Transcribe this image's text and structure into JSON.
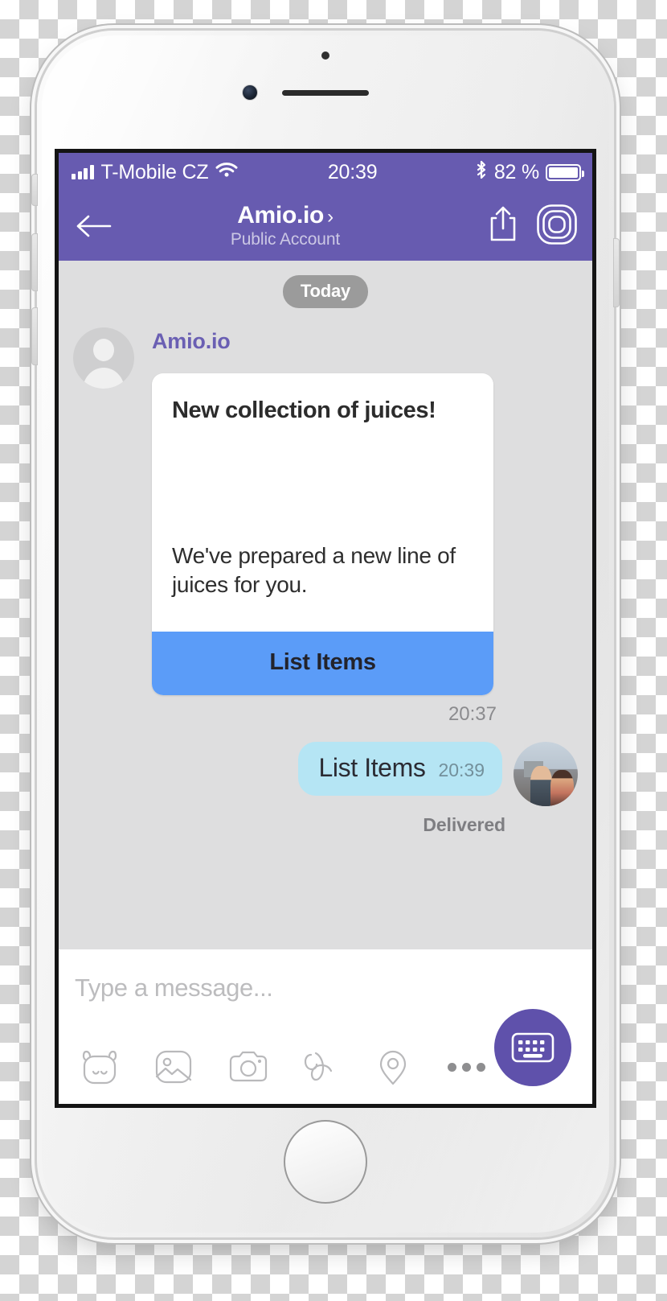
{
  "status_bar": {
    "carrier": "T-Mobile CZ",
    "time": "20:39",
    "battery_percent": "82 %",
    "icons": [
      "signal-bars-icon",
      "wifi-icon",
      "bluetooth-icon",
      "battery-icon"
    ]
  },
  "header": {
    "back_icon": "back-arrow-icon",
    "title": "Amio.io",
    "chevron": "›",
    "subtitle": "Public Account",
    "actions": [
      "share-icon",
      "viber-camera-icon"
    ],
    "background_color": "#675bb0"
  },
  "conversation": {
    "day_separator": "Today",
    "incoming": {
      "sender": "Amio.io",
      "avatar": "default-avatar-icon",
      "card": {
        "title": "New collection of juices!",
        "text": "We've prepared a new line of juices for you.",
        "button_label": "List Items",
        "button_color": "#5b9cf8"
      },
      "timestamp": "20:37"
    },
    "outgoing": {
      "text": "List Items",
      "timestamp": "20:39",
      "status": "Delivered",
      "avatar": "user-photo-avatar",
      "bubble_color": "#b5e5f4"
    }
  },
  "composer": {
    "placeholder": "Type a message...",
    "icons": [
      {
        "name": "sticker-icon",
        "label": "Stickers"
      },
      {
        "name": "gallery-icon",
        "label": "Gallery"
      },
      {
        "name": "camera-icon",
        "label": "Camera"
      },
      {
        "name": "doodle-icon",
        "label": "Doodle"
      },
      {
        "name": "location-pin-icon",
        "label": "Location"
      },
      {
        "name": "more-dots-icon",
        "label": "More"
      }
    ],
    "keyboard_button": "keyboard-icon",
    "keyboard_button_color": "#5f51ab"
  }
}
